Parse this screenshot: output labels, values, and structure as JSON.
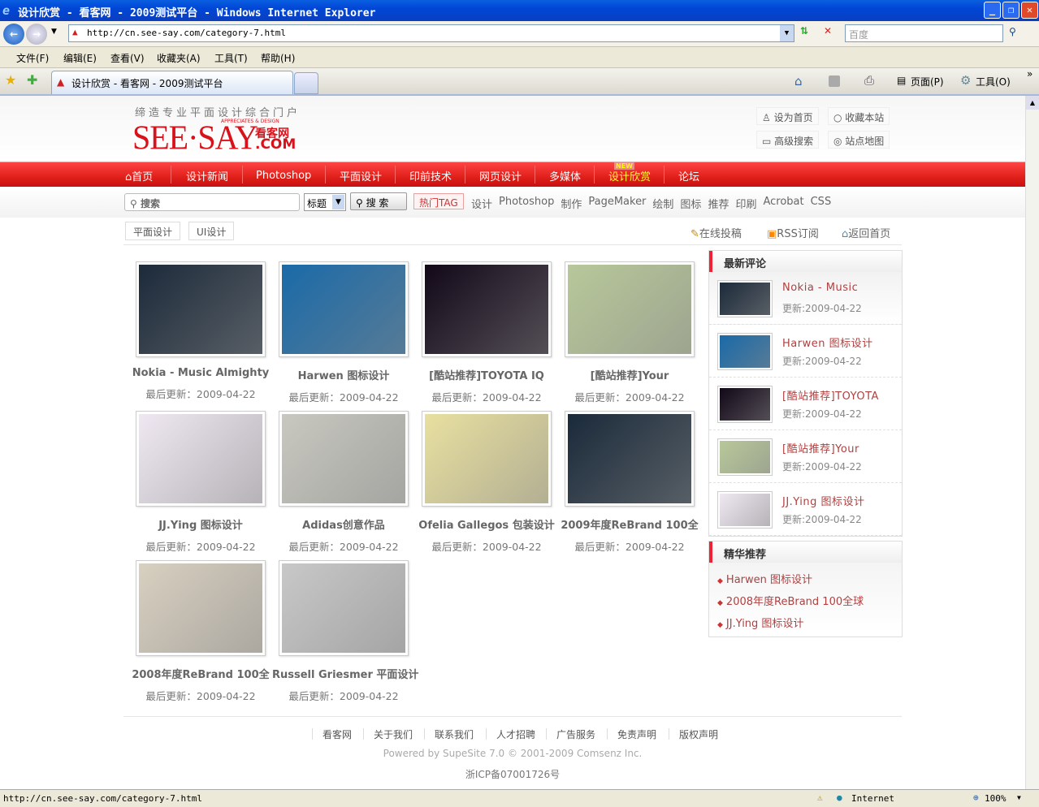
{
  "window": {
    "title": "设计欣赏 - 看客网 - 2009测试平台 - Windows Internet Explorer"
  },
  "browser": {
    "url": "http://cn.see-say.com/category-7.html",
    "search_placeholder": "百度",
    "menu": [
      "文件(F)",
      "编辑(E)",
      "查看(V)",
      "收藏夹(A)",
      "工具(T)",
      "帮助(H)"
    ],
    "tab_title": "设计欣赏 - 看客网 - 2009测试平台",
    "cmd_page": "页面(P)",
    "cmd_tools": "工具(O)",
    "status_url": "http://cn.see-say.com/category-7.html",
    "zone": "Internet",
    "zoom": "100%"
  },
  "header": {
    "slogan": "缔造专业平面设计综合门户",
    "logo": "SEE·SAY",
    "logo_cn": "看客网",
    "logo_com": ".COM",
    "logo_sub": "APPRECIATES & DESIGN",
    "links": [
      "设为首页",
      "收藏本站",
      "高级搜索",
      "站点地图"
    ]
  },
  "nav": {
    "items": [
      "首页",
      "设计新闻",
      "Photoshop",
      "平面设计",
      "印前技术",
      "网页设计",
      "多媒体",
      "设计欣赏",
      "论坛"
    ],
    "new_badge": "NEW",
    "active": "设计欣赏"
  },
  "search": {
    "placeholder": "搜索",
    "select": "标题",
    "button": "搜 索",
    "hot_label": "热门TAG",
    "tags": [
      "设计",
      "Photoshop",
      "制作",
      "PageMaker",
      "绘制",
      "图标",
      "推荐",
      "印刷",
      "Acrobat",
      "CSS"
    ]
  },
  "subnav": {
    "tabs": [
      "平面设计",
      "UI设计"
    ],
    "links": [
      "在线投稿",
      "RSS订阅",
      "返回首页"
    ]
  },
  "gallery": [
    {
      "title": "Nokia - Music Almighty",
      "date": "最后更新：2009-04-22",
      "c": "#1c2a3a"
    },
    {
      "title": "Harwen 图标设计",
      "date": "最后更新：2009-04-22",
      "c": "#1a6aa8"
    },
    {
      "title": "[酷站推荐]TOYOTA IQ",
      "date": "最后更新：2009-04-22",
      "c": "#120818"
    },
    {
      "title": "[酷站推荐]Your",
      "date": "最后更新：2009-04-22",
      "c": "#b8c89a"
    },
    {
      "title": "JJ.Ying 图标设计",
      "date": "最后更新：2009-04-22",
      "c": "#efe8f2"
    },
    {
      "title": "Adidas创意作品",
      "date": "最后更新：2009-04-22",
      "c": "#c8c8c0"
    },
    {
      "title": "Ofelia Gallegos 包装设计",
      "date": "最后更新：2009-04-22",
      "c": "#e8e0a0"
    },
    {
      "title": "2009年度ReBrand 100全",
      "date": "最后更新：2009-04-22",
      "c": "#1a2a3a"
    },
    {
      "title": "2008年度ReBrand 100全",
      "date": "最后更新：2009-04-22",
      "c": "#d8d0c0"
    },
    {
      "title": "Russell Griesmer 平面设计",
      "date": "最后更新：2009-04-22",
      "c": "#c8c8c8"
    }
  ],
  "sidebar": {
    "latest_title": "最新评论",
    "latest": [
      {
        "title": "Nokia - Music",
        "date": "更新:2009-04-22",
        "c": "#1c2a3a"
      },
      {
        "title": "Harwen 图标设计",
        "date": "更新:2009-04-22",
        "c": "#1a6aa8"
      },
      {
        "title": "[酷站推荐]TOYOTA",
        "date": "更新:2009-04-22",
        "c": "#120818"
      },
      {
        "title": "[酷站推荐]Your",
        "date": "更新:2009-04-22",
        "c": "#b8c89a"
      },
      {
        "title": "JJ.Ying 图标设计",
        "date": "更新:2009-04-22",
        "c": "#efe8f2"
      }
    ],
    "rec_title": "精华推荐",
    "rec": [
      "Harwen 图标设计",
      "2008年度ReBrand 100全球",
      "JJ.Ying 图标设计"
    ]
  },
  "footer": {
    "links": [
      "看客网",
      "关于我们",
      "联系我们",
      "人才招聘",
      "广告服务",
      "免责声明",
      "版权声明"
    ],
    "powered": "Powered by SupeSite 7.0 © 2001-2009 Comsenz Inc.",
    "icp": "浙ICP备07001726号"
  }
}
